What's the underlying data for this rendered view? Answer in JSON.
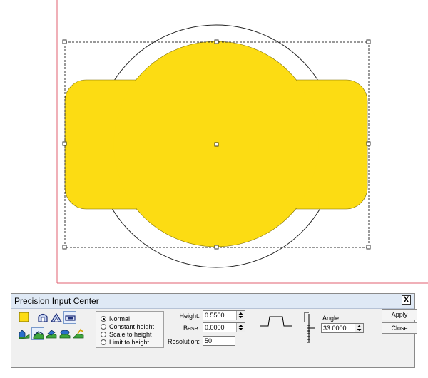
{
  "panel": {
    "title": "Precision Input Center",
    "close_label": "X"
  },
  "colors": {
    "shape_fill": "#fcdc13",
    "canvas_border": "#e06070",
    "panel_bg": "#f0f0f0"
  },
  "modes": [
    {
      "label": "Normal",
      "checked": true
    },
    {
      "label": "Constant height",
      "checked": false
    },
    {
      "label": "Scale to height",
      "checked": false
    },
    {
      "label": "Limit to height",
      "checked": false
    }
  ],
  "fields": {
    "height_label": "Height:",
    "height_value": "0.5500",
    "base_label": "Base:",
    "base_value": "0.0000",
    "resolution_label": "Resolution:",
    "resolution_value": "50",
    "angle_label": "Angle:",
    "angle_value": "33.0000"
  },
  "buttons": {
    "apply": "Apply",
    "close": "Close"
  },
  "tools": [
    "color-swatch-icon",
    "dome-icon",
    "peak-icon",
    "flat-box-icon",
    "terrain-1-icon",
    "terrain-2-icon",
    "terrain-3-icon",
    "terrain-4-icon",
    "terrain-5-icon"
  ]
}
